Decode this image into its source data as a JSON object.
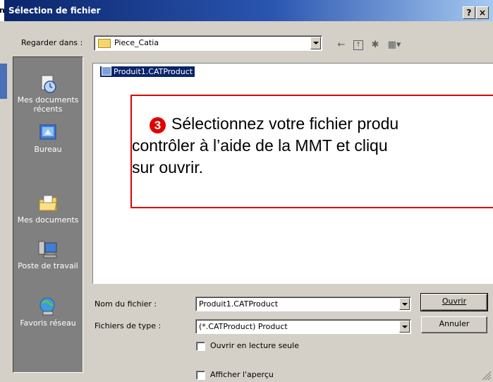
{
  "dialog": {
    "title": "Sélection de fichier",
    "help_button": "?",
    "close_button": "×",
    "left_fragment": "n"
  },
  "lookin": {
    "label": "Regarder dans :",
    "value": "Piece_Catia"
  },
  "toolbar": {
    "back_icon": "back-arrow-icon",
    "up_icon": "up-folder-icon",
    "new_folder_icon": "new-folder-icon",
    "view_menu_icon": "view-menu-icon"
  },
  "places": [
    {
      "label_line1": "Mes documents",
      "label_line2": "récents",
      "icon": "recent-documents-icon"
    },
    {
      "label_line1": "Bureau",
      "label_line2": "",
      "icon": "desktop-icon"
    },
    {
      "label_line1": "Mes documents",
      "label_line2": "",
      "icon": "my-documents-icon"
    },
    {
      "label_line1": "Poste de travail",
      "label_line2": "",
      "icon": "my-computer-icon"
    },
    {
      "label_line1": "Favoris réseau",
      "label_line2": "",
      "icon": "network-places-icon"
    }
  ],
  "files": [
    {
      "name": "Produit1.CATProduct",
      "selected": true
    }
  ],
  "callout": {
    "number": "3",
    "line1": "Sélectionnez votre fichier produ",
    "line2": "contrôler à l’aide de la MMT et cliqu",
    "line3": "sur ouvrir.",
    "border_color": "#e00000"
  },
  "filename": {
    "label": "Nom du fichier :",
    "value": "Produit1.CATProduct"
  },
  "filetype": {
    "label": "Fichiers de type :",
    "value": "(*.CATProduct) Product"
  },
  "buttons": {
    "open": "Ouvrir",
    "cancel": "Annuler"
  },
  "options": {
    "readonly_label": "Ouvrir en lecture seule",
    "readonly_checked": false,
    "preview_label": "Afficher l'aperçu",
    "preview_checked": false
  },
  "colors": {
    "titlebar": "#0a246a",
    "selection": "#0a246a",
    "dialog_bg": "#d4d0c8"
  }
}
